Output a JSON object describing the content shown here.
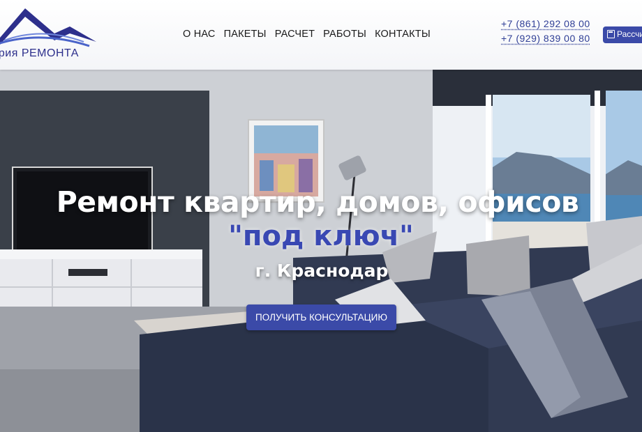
{
  "header": {
    "logo_text": "ритория РЕМОНТА",
    "nav": [
      "О НАС",
      "ПАКЕТЫ",
      "РАСЧЕТ",
      "РАБОТЫ",
      "КОНТАКТЫ"
    ],
    "phones": [
      "+7 (861) 292 08 00",
      "+7 (929) 839 00 80"
    ],
    "calc_button": "Рассчи"
  },
  "hero": {
    "title": "Ремонт квартир, домов, офисов",
    "accent": "\"под ключ\"",
    "city": "г. Краснодар",
    "cta": "ПОЛУЧИТЬ КОНСУЛЬТАЦИЮ"
  },
  "colors": {
    "brand": "#3b4aa8",
    "accent_text": "#3948b3",
    "logo": "#2d2f8c"
  },
  "icons": {
    "calc_button": "calculator-icon",
    "logo": "roof-mountain-icon"
  }
}
